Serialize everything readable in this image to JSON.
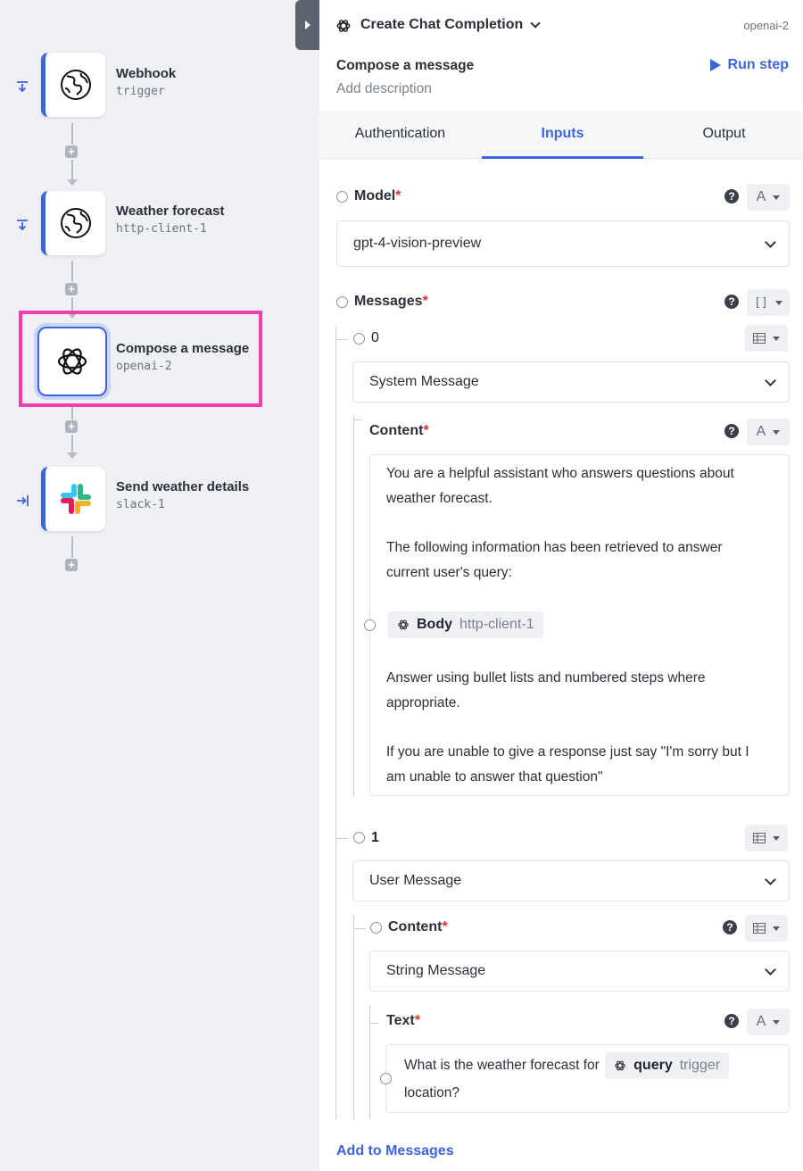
{
  "canvas": {
    "nodes": [
      {
        "title": "Webhook",
        "subtitle": "trigger",
        "icon": "globe-icon"
      },
      {
        "title": "Weather forecast",
        "subtitle": "http-client-1",
        "icon": "globe-icon"
      },
      {
        "title": "Compose a message",
        "subtitle": "openai-2",
        "icon": "openai-icon"
      },
      {
        "title": "Send weather details",
        "subtitle": "slack-1",
        "icon": "slack-icon"
      }
    ],
    "accent_color": "#3d63dd",
    "highlight_color": "#f23fae"
  },
  "panel": {
    "action_title": "Create Chat Completion",
    "step_id": "openai-2",
    "step_name": "Compose a message",
    "add_description": "Add description",
    "run_step": "Run step",
    "tabs": [
      {
        "label": "Authentication"
      },
      {
        "label": "Inputs"
      },
      {
        "label": "Output"
      }
    ],
    "active_tab": "Inputs",
    "model": {
      "label": "Model",
      "required": "*",
      "value": "gpt-4-vision-preview"
    },
    "messages": {
      "label": "Messages",
      "required": "*",
      "items": [
        {
          "index": "0",
          "type": "System Message",
          "content_label": "Content",
          "content_required": "*",
          "paragraphs": [
            "You are a helpful assistant who answers questions about weather forecast.",
            "The following information has been retrieved to answer current user's query:",
            "Answer using bullet lists and numbered steps where appropriate.",
            "If you are unable to give a response just say \"I'm sorry but I am unable to answer that question\""
          ],
          "chip": {
            "name": "Body",
            "source": "http-client-1"
          }
        },
        {
          "index": "1",
          "type": "User Message",
          "content_label": "Content",
          "content_required": "*",
          "content_type": "String Message",
          "text_label": "Text",
          "text_required": "*",
          "text_before": "What is the weather forecast for",
          "chip": {
            "name": "query",
            "source": "trigger"
          },
          "text_after": "location?"
        }
      ],
      "add_label": "Add to Messages"
    }
  }
}
